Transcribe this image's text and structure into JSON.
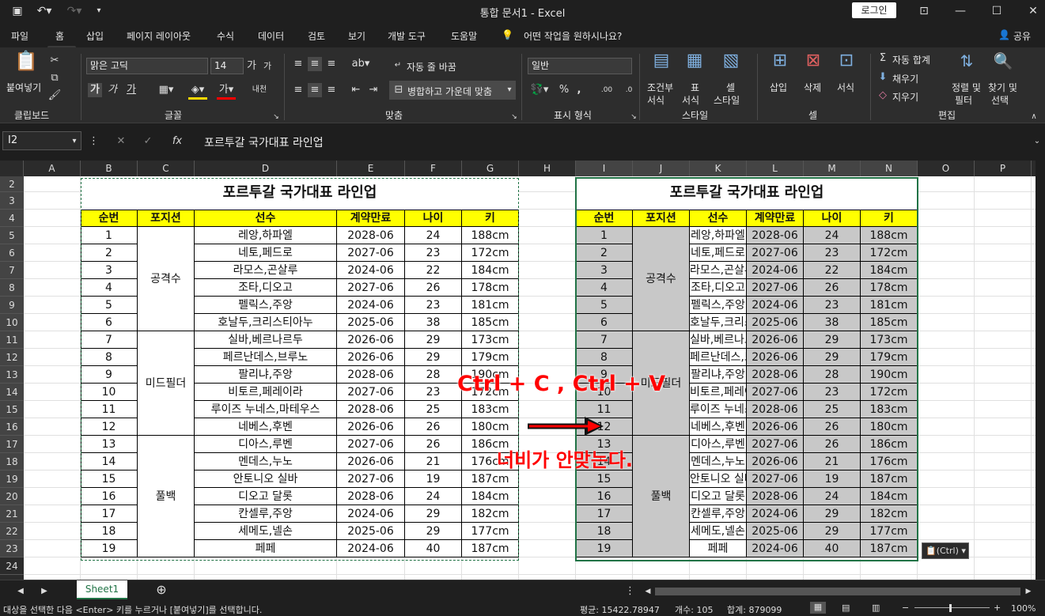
{
  "app": {
    "title": "통합 문서1  -  Excel",
    "login": "로그인"
  },
  "menu": {
    "items": [
      "파일",
      "홈",
      "삽입",
      "페이지 레이아웃",
      "수식",
      "데이터",
      "검토",
      "보기",
      "개발 도구",
      "도움말"
    ],
    "tell_me": "어떤 작업을 원하시나요?",
    "share": "공유"
  },
  "ribbon": {
    "paste": "붙여넣기",
    "clipboard": "클립보드",
    "font_name": "맑은 고딕",
    "font_size": "14",
    "font_group": "글꼴",
    "wrap_text": "자동 줄 바꿈",
    "merge_center": "병합하고 가운데 맞춤",
    "align_group": "맞춤",
    "number_format": "일반",
    "number_group": "표시 형식",
    "cond_format": [
      "조건부",
      "서식"
    ],
    "table_format": [
      "표",
      "서식"
    ],
    "cell_style": [
      "셀",
      "스타일"
    ],
    "style_group": "스타일",
    "insert": "삽입",
    "delete": "삭제",
    "format": "서식",
    "cells_group": "셀",
    "autosum": "자동 합계",
    "fill": "채우기",
    "clear": "지우기",
    "sort_filter": [
      "정렬 및",
      "필터"
    ],
    "find_select": [
      "찾기 및",
      "선택"
    ],
    "edit_group": "편집"
  },
  "formula": {
    "name_box": "I2",
    "fx": "fx",
    "content": "포르투갈 국가대표 라인업"
  },
  "columns": [
    "A",
    "B",
    "C",
    "D",
    "E",
    "F",
    "G",
    "H",
    "I",
    "J",
    "K",
    "L",
    "M",
    "N",
    "O",
    "P"
  ],
  "rows": [
    "2",
    "3",
    "4",
    "5",
    "6",
    "7",
    "8",
    "9",
    "10",
    "11",
    "12",
    "13",
    "14",
    "15",
    "16",
    "17",
    "18",
    "19",
    "20",
    "21",
    "22",
    "23",
    "24"
  ],
  "table": {
    "title": "포르투갈 국가대표 라인업",
    "headers": [
      "순번",
      "포지션",
      "선수",
      "계약만료",
      "나이",
      "키"
    ],
    "positions": [
      "공격수",
      "미드필더",
      "풀백"
    ],
    "players": [
      [
        "1",
        "레앙,하파엘",
        "2028-06",
        "24",
        "188cm"
      ],
      [
        "2",
        "네토,페드로",
        "2027-06",
        "23",
        "172cm"
      ],
      [
        "3",
        "라모스,곤살루",
        "2024-06",
        "22",
        "184cm"
      ],
      [
        "4",
        "조타,디오고",
        "2027-06",
        "26",
        "178cm"
      ],
      [
        "5",
        "펠릭스,주앙",
        "2024-06",
        "23",
        "181cm"
      ],
      [
        "6",
        "호날두,크리스티아누",
        "2025-06",
        "38",
        "185cm"
      ],
      [
        "7",
        "실바,베르나르두",
        "2026-06",
        "29",
        "173cm"
      ],
      [
        "8",
        "페르난데스,브루노",
        "2026-06",
        "29",
        "179cm"
      ],
      [
        "9",
        "팔리냐,주앙",
        "2028-06",
        "28",
        "190cm"
      ],
      [
        "10",
        "비토르,페레이라",
        "2027-06",
        "23",
        "172cm"
      ],
      [
        "11",
        "루이즈 누네스,마테우스",
        "2028-06",
        "25",
        "183cm"
      ],
      [
        "12",
        "네베스,후벤",
        "2026-06",
        "26",
        "180cm"
      ],
      [
        "13",
        "디아스,루벤",
        "2027-06",
        "26",
        "186cm"
      ],
      [
        "14",
        "멘데스,누노",
        "2026-06",
        "21",
        "176cm"
      ],
      [
        "15",
        "안토니오 실바",
        "2027-06",
        "19",
        "187cm"
      ],
      [
        "16",
        "디오고 달롯",
        "2028-06",
        "24",
        "184cm"
      ],
      [
        "17",
        "칸셀루,주앙",
        "2024-06",
        "29",
        "182cm"
      ],
      [
        "18",
        "세메도,넬손",
        "2025-06",
        "29",
        "177cm"
      ],
      [
        "19",
        "페페",
        "2024-06",
        "40",
        "187cm"
      ]
    ]
  },
  "annotations": {
    "shortcut": "Ctrl + C , Ctrl + V",
    "note": "너비가 안맞는다."
  },
  "paste_options": "(Ctrl)",
  "sheet": {
    "name": "Sheet1"
  },
  "status": {
    "message": "대상을 선택한 다음 &lt;Enter&gt; 키를 누르거나 [붙여넣기]를 선택합니다.",
    "average": "평균: 15422.78947",
    "count": "개수: 105",
    "sum": "합계: 879099",
    "zoom": "100%"
  },
  "colors": {
    "header_yellow": "#ffff00",
    "excel_green": "#217346",
    "annotation_red": "#ff0000",
    "paste_fill": "#c8c8c8"
  }
}
